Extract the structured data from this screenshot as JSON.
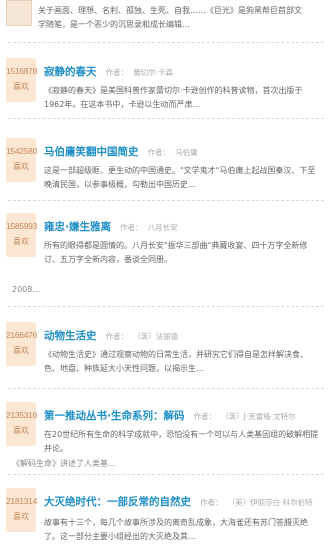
{
  "top_fragment": {
    "text": "关于画面、理想、名利、孤独、生死、自我……《巨光》是狗黑帮巨首部文学随笔，是一个恶少的沉思录和成长编辑…"
  },
  "labels": {
    "author": "作者：",
    "likes": "喜欢"
  },
  "books": [
    {
      "count": "1516878",
      "title": "寂静的春天",
      "author": "蕾切尔·卡森",
      "desc": "《寂静的春天》是美国科普作家蕾切尔·卡逊创作的科普读物，首次出版于1962年。在这本书中，卡逊以生动而严肃…"
    },
    {
      "count": "1542580",
      "title": "马伯庸笑翻中国简史",
      "author": "马伯庸",
      "desc": "这是一部超级眶、更生动的中国通史。\"文学鬼才\"马伯庸上起战国秦汉、下至晚清民国，以参事极概，勾勒出中国历史…"
    },
    {
      "count": "1585993",
      "title": "雍忠·嫌生雅离",
      "author": "八月长安",
      "desc": "所有的眼得都是圆情的。八月长安\"振华三部曲\"典藏收宴、四十万字全新修订、五万字全新内容，番谈全同册。",
      "extra": "2008…"
    },
    {
      "count": "2166476",
      "title": "动物生活史",
      "author": "（英）法丽德",
      "desc": "《动物生活史》通过观察动物的日常生活，并研究它们得自是怎样解决食、色、地盘、种族延大小天性问题，以揭示生…"
    },
    {
      "count": "2135316",
      "title": "第一推动丛书·生命系列：解码",
      "author": "（英）J·克雷格·文特尔",
      "desc": "在20世纪所有生命的科学成就中，恐怕没有一个可以与人类基因组的破解相提并论。",
      "extra": "《解码生命》讲述了人类基…"
    },
    {
      "count": "2181314",
      "title": "大灭绝时代：一部反常的自然史",
      "author": "（美）伊丽莎白·科尔伯特",
      "desc": "故事有十三个，每几个故事所涉及的离奇乱成象，大海雀还有苏门答腊灭绝了。这一部分主要小组经出的大灭绝及其…"
    }
  ]
}
